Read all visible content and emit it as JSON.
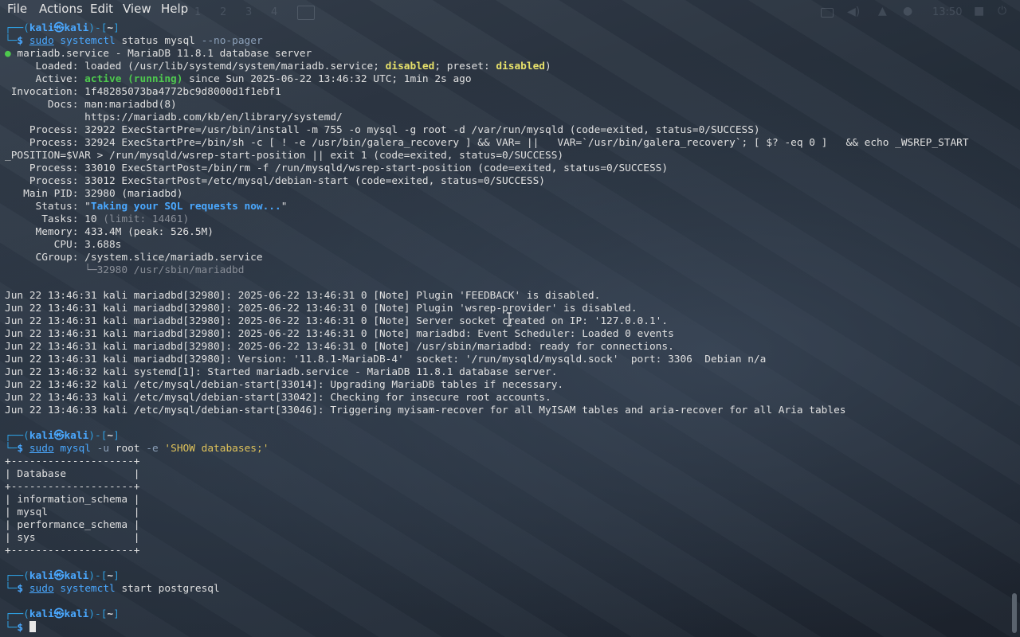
{
  "menubar": {
    "file": "File",
    "actions": "Actions",
    "edit": "Edit",
    "view": "View",
    "help": "Help"
  },
  "panel": {
    "workspaces": [
      "1",
      "2",
      "3",
      "4"
    ],
    "clock": "13:50"
  },
  "prompt": {
    "corner": "┌──(",
    "user": "kali",
    "at": "㉿",
    "host": "kali",
    "mid": ")-[",
    "dir": "~",
    "end": "]",
    "arrow": "└─",
    "dollar": "$ "
  },
  "cmd1": {
    "sudo": "sudo",
    "prog": "systemctl",
    "args": " status mysql ",
    "opt": "--no-pager"
  },
  "status": {
    "bullet": "●",
    "header": " mariadb.service - MariaDB 11.8.1 database server",
    "loaded_a": "     Loaded: loaded (/usr/lib/systemd/system/mariadb.service; ",
    "loaded_disabled": "disabled",
    "loaded_b": "; preset: ",
    "loaded_preset": "disabled",
    "loaded_c": ")",
    "active_a": "     Active: ",
    "active_state": "active (running)",
    "active_b": " since Sun 2025-06-22 13:46:32 UTC; 1min 2s ago",
    "invocation": " Invocation: 1f48285073ba4772bc9d8000d1f1ebf1",
    "docs1": "       Docs: man:mariadbd(8)",
    "docs2": "             https://mariadb.com/kb/en/library/systemd/",
    "proc1": "    Process: 32922 ExecStartPre=/usr/bin/install -m 755 -o mysql -g root -d /var/run/mysqld (code=exited, status=0/SUCCESS)",
    "proc2a": "    Process: 32924 ExecStartPre=/bin/sh -c [ ! -e /usr/bin/galera_recovery ] && VAR= ||   VAR=`/usr/bin/galera_recovery`; [ $? -eq 0 ]   && echo _WSREP_START",
    "proc2b": "_POSITION=$VAR > /run/mysqld/wsrep-start-position || exit 1 (code=exited, status=0/SUCCESS)",
    "proc3": "    Process: 33010 ExecStartPost=/bin/rm -f /run/mysqld/wsrep-start-position (code=exited, status=0/SUCCESS)",
    "proc4": "    Process: 33012 ExecStartPost=/etc/mysql/debian-start (code=exited, status=0/SUCCESS)",
    "mainpid": "   Main PID: 32980 (mariadbd)",
    "status_a": "     Status: \"",
    "status_msg": "Taking your SQL requests now...",
    "status_b": "\"",
    "tasks_a": "      Tasks: 10 ",
    "tasks_limit": "(limit: 14461)",
    "memory": "     Memory: 433.4M (peak: 526.5M)",
    "cpu": "        CPU: 3.688s",
    "cgroup": "     CGroup: /system.slice/mariadb.service",
    "cgroup_child": "             └─32980 /usr/sbin/mariadbd"
  },
  "journal": [
    "Jun 22 13:46:31 kali mariadbd[32980]: 2025-06-22 13:46:31 0 [Note] Plugin 'FEEDBACK' is disabled.",
    "Jun 22 13:46:31 kali mariadbd[32980]: 2025-06-22 13:46:31 0 [Note] Plugin 'wsrep-provider' is disabled.",
    "Jun 22 13:46:31 kali mariadbd[32980]: 2025-06-22 13:46:31 0 [Note] Server socket created on IP: '127.0.0.1'.",
    "Jun 22 13:46:31 kali mariadbd[32980]: 2025-06-22 13:46:31 0 [Note] mariadbd: Event Scheduler: Loaded 0 events",
    "Jun 22 13:46:31 kali mariadbd[32980]: 2025-06-22 13:46:31 0 [Note] /usr/sbin/mariadbd: ready for connections.",
    "Jun 22 13:46:31 kali mariadbd[32980]: Version: '11.8.1-MariaDB-4'  socket: '/run/mysqld/mysqld.sock'  port: 3306  Debian n/a",
    "Jun 22 13:46:32 kali systemd[1]: Started mariadb.service - MariaDB 11.8.1 database server.",
    "Jun 22 13:46:32 kali /etc/mysql/debian-start[33014]: Upgrading MariaDB tables if necessary.",
    "Jun 22 13:46:33 kali /etc/mysql/debian-start[33042]: Checking for insecure root accounts.",
    "Jun 22 13:46:33 kali /etc/mysql/debian-start[33046]: Triggering myisam-recover for all MyISAM tables and aria-recover for all Aria tables"
  ],
  "cmd2": {
    "sudo": "sudo",
    "prog": "mysql",
    "opt1": " -u",
    "args": " root ",
    "opt2": "-e",
    "space": " ",
    "str": "'SHOW databases;'"
  },
  "dbtable": {
    "border": "+--------------------+",
    "header": "| Database           |",
    "rows": [
      "| information_schema |",
      "| mysql              |",
      "| performance_schema |",
      "| sys                |"
    ]
  },
  "cmd3": {
    "sudo": "sudo",
    "prog": "systemctl",
    "args": " start postgresql"
  }
}
